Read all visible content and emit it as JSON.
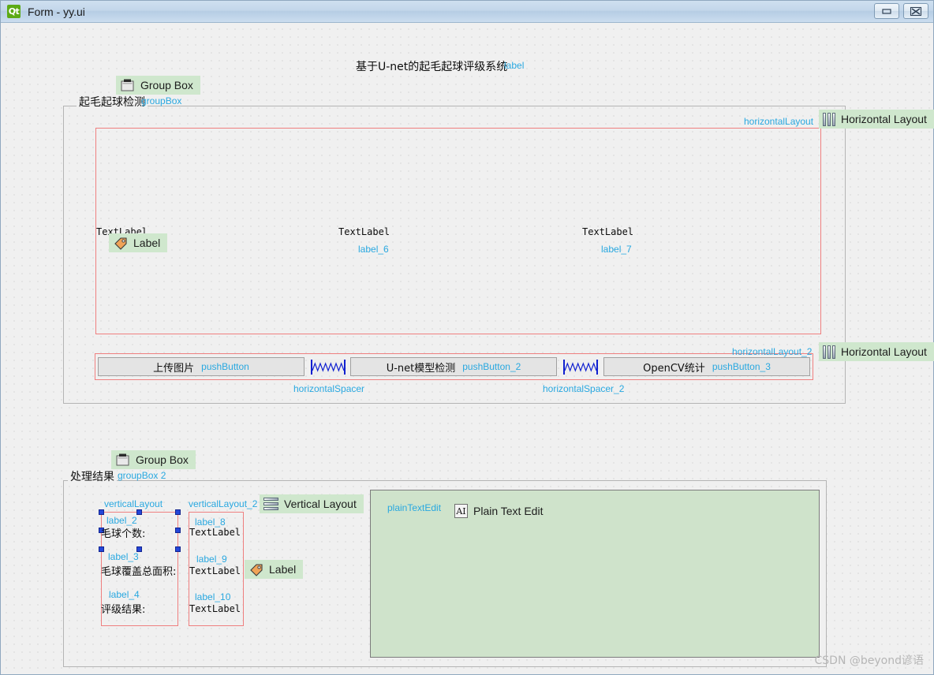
{
  "window": {
    "title": "Form - yy.ui",
    "logo_text": "Qt",
    "minimize_label": "Minimize",
    "close_label": "Close"
  },
  "form": {
    "title_label": {
      "text": "基于U-net的起毛起球评级系统",
      "objname": "label"
    },
    "group_box_1": {
      "title": "起毛起球检测",
      "objname": "groupBox",
      "badge": "Group Box",
      "badge_icon": "group-box-icon"
    },
    "group_box_2": {
      "title": "处理结果",
      "objname": "groupBox 2",
      "badge": "Group Box",
      "badge_icon": "group-box-icon"
    },
    "horizontal_layout_1": {
      "objname": "horizontalLayout",
      "badge": "Horizontal Layout",
      "badge_icon": "horizontal-layout-icon"
    },
    "horizontal_layout_2": {
      "objname": "horizontalLayout_2",
      "badge": "Horizontal Layout",
      "badge_icon": "horizontal-layout-icon"
    },
    "vertical_layout_1": {
      "objname": "verticalLayout"
    },
    "vertical_layout_2": {
      "objname": "verticalLayout_2",
      "badge": "Vertical Layout",
      "badge_icon": "vertical-layout-icon"
    },
    "image_labels": [
      {
        "text": "TextLabel",
        "objname": "label_5"
      },
      {
        "text": "TextLabel",
        "objname": "label_6"
      },
      {
        "text": "TextLabel",
        "objname": "label_7"
      }
    ],
    "label_badge_1": {
      "badge": "Label",
      "badge_icon": "tag-icon"
    },
    "label_badge_2": {
      "badge": "Label",
      "badge_icon": "tag-icon"
    },
    "buttons": [
      {
        "text": "上传图片",
        "objname": "pushButton"
      },
      {
        "text": "U-net模型检测",
        "objname": "pushButton_2"
      },
      {
        "text": "OpenCV统计",
        "objname": "pushButton_3"
      }
    ],
    "spacers": [
      {
        "objname": "horizontalSpacer",
        "icon": "horizontal-spring-icon"
      },
      {
        "objname": "horizontalSpacer_2",
        "icon": "horizontal-spring-icon"
      }
    ],
    "result_labels": [
      {
        "text": "毛球个数:",
        "objname": "label_2"
      },
      {
        "text": "毛球覆盖总面积:",
        "objname": "label_3"
      },
      {
        "text": "评级结果:",
        "objname": "label_4"
      }
    ],
    "result_values": [
      {
        "text": "TextLabel",
        "objname": "label_8"
      },
      {
        "text": "TextLabel",
        "objname": "label_9"
      },
      {
        "text": "TextLabel",
        "objname": "label_10"
      }
    ],
    "plain_text_edit": {
      "objname": "plainTextEdit",
      "badge": "Plain Text Edit",
      "badge_icon": "ai-icon",
      "icon_text": "AI",
      "value": ""
    }
  },
  "watermark": "CSDN @beyond谚语",
  "colors": {
    "titlebar": "#c2d6ea",
    "qt_green": "#5caa15",
    "objname_blue": "#29a8e0",
    "badge_green": "#cfe7cd",
    "layout_red": "#ef7f7f",
    "handle_blue": "#2546d8",
    "plaintext_green": "#cfe3cb",
    "canvas": "#f0f0f0"
  }
}
